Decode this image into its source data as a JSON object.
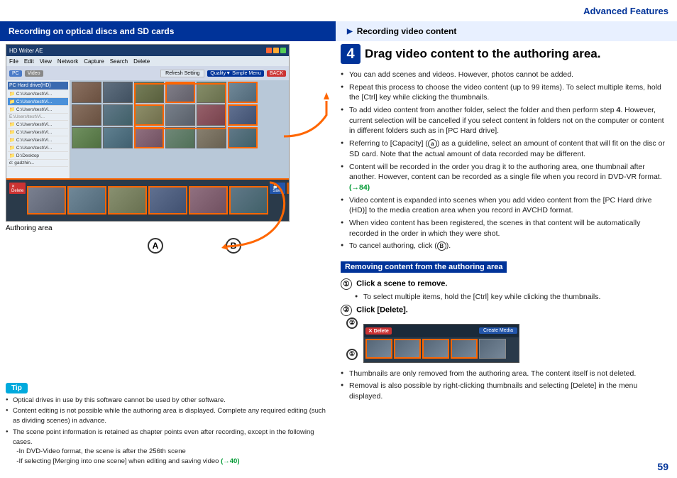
{
  "header": {
    "title": "Advanced Features",
    "section_left": "Recording on optical discs and SD cards",
    "section_right": "Recording video content"
  },
  "step": {
    "number": "4",
    "title": "Drag video content to the authoring area."
  },
  "bullets": [
    "You can add scenes and videos. However, photos cannot be added.",
    "Repeat this process to choose the video content (up to 99 items). To select multiple items, hold the [Ctrl] key while clicking the thumbnails.",
    "To add video content from another folder, select the folder and then perform step 4. However, current selection will be cancelled if you select content in folders not on the computer or content in different folders such as in [PC Hard drive].",
    "Referring to [Capacity] (  ) as a guideline, select an amount of content that will fit on the disc or SD card. Note that the actual amount of data recorded may be different.",
    "Content will be recorded in the order you drag it to the authoring area, one thumbnail after another. However, content can be recorded as a single file when you record in DVD-VR format. (→84)",
    "Video content is expanded into scenes when you add video content from the [PC Hard drive (HD)] to the media creation area when you record in AVCHD format.",
    "When video content has been registered, the scenes in that content will be automatically recorded in the order in which they were shot.",
    "To cancel authoring, click (  )."
  ],
  "removing_section": {
    "title": "Removing content from the authoring area",
    "step1": "Click a scene to remove.",
    "step1_sub": "To select multiple items, hold the [Ctrl] key while clicking the thumbnails.",
    "step2": "Click [Delete].",
    "note1": "Thumbnails are only removed from the authoring area. The content itself is not deleted.",
    "note2": "Removal is also possible by right-clicking thumbnails and selecting [Delete] in the menu displayed."
  },
  "tip": {
    "label": "Tip",
    "items": [
      "Optical drives in use by this software cannot be used by other software.",
      "Content editing is not possible while the authoring area is displayed. Complete any required editing (such as dividing scenes) in advance.",
      "The scene point information is retained as chapter points even after recording, except in the following cases.\n-In DVD-Video format, the scene is after the 256th scene\n-If selecting [Merging into one scene] when editing and saving video (→40)"
    ]
  },
  "authoring_area_label": "Authoring area",
  "label_A": "A",
  "label_B": "B",
  "page_number": "59",
  "link_84": "(→84)",
  "link_40": "(→40)"
}
